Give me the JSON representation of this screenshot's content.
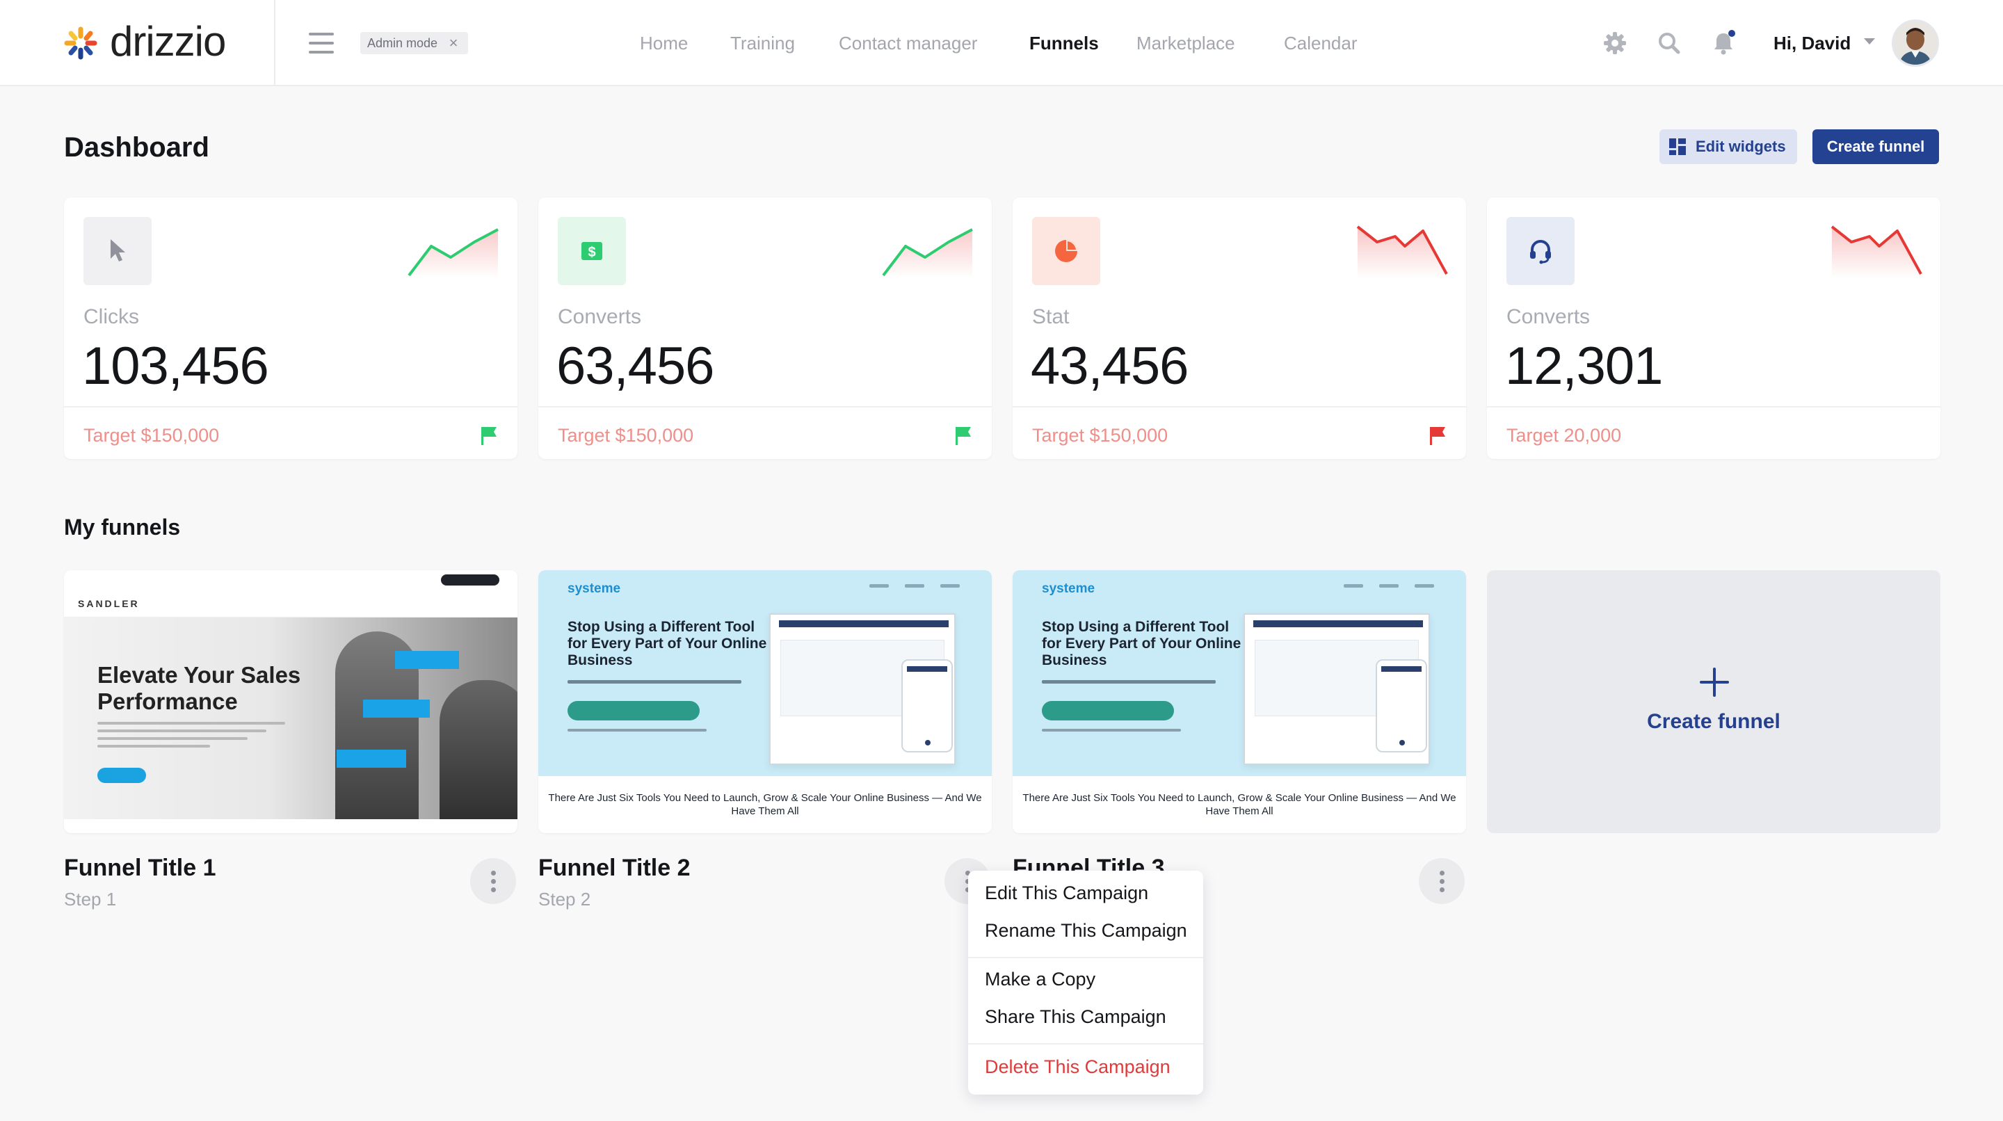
{
  "header": {
    "logo_text": "drizzio",
    "admin_chip": "Admin mode",
    "admin_chip_close": "×",
    "nav": [
      "Home",
      "Training",
      "Contact manager",
      "Funnels",
      "Marketplace",
      "Calendar"
    ],
    "active_nav": "Funnels",
    "greeting": "Hi, David"
  },
  "page": {
    "title": "Dashboard",
    "edit_widgets": "Edit widgets",
    "create_funnel": "Create funnel"
  },
  "stats": [
    {
      "label": "Clicks",
      "value": "103,456",
      "target": "Target $150,000",
      "trend": "up",
      "icon": "cursor-icon",
      "flag": "green"
    },
    {
      "label": "Converts",
      "value": "63,456",
      "target": "Target $150,000",
      "trend": "up",
      "icon": "dollar-icon",
      "flag": "green"
    },
    {
      "label": "Stat",
      "value": "43,456",
      "target": "Target $150,000",
      "trend": "down",
      "icon": "pie-chart-icon",
      "flag": "red"
    },
    {
      "label": "Converts",
      "value": "12,301",
      "target": "Target 20,000",
      "trend": "down",
      "icon": "headset-icon",
      "flag": "none"
    }
  ],
  "funnels_section": {
    "title": "My funnels",
    "items": [
      {
        "title": "Funnel Title 1",
        "step": "Step 1"
      },
      {
        "title": "Funnel Title 2",
        "step": "Step 2"
      },
      {
        "title": "Funnel Title 3",
        "step": ""
      }
    ],
    "create_label": "Create funnel"
  },
  "thumbnails": {
    "sandler_logo": "SANDLER",
    "sandler_headline": "Elevate Your Sales Performance",
    "systeme_logo": "systeme",
    "systeme_headline": "Stop Using a Different Tool for Every Part of Your Online Business",
    "systeme_bottom": "There Are Just Six Tools You Need to Launch, Grow & Scale Your Online Business — And We Have Them All"
  },
  "context_menu": {
    "items": [
      "Edit This Campaign",
      "Rename This Campaign",
      "Make a Copy",
      "Share This Campaign",
      "Delete This Campaign"
    ]
  },
  "colors": {
    "brand_blue": "#234392",
    "positive": "#2ecc71",
    "negative": "#e53935",
    "target_text": "#f08e8a"
  }
}
